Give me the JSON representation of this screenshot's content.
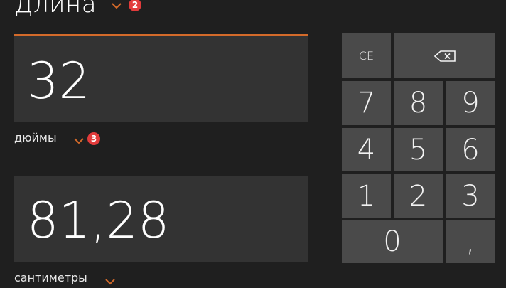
{
  "header": {
    "title": "Длина",
    "badge": "2"
  },
  "from": {
    "value": "32",
    "unit": "дюймы",
    "badge": "3"
  },
  "to": {
    "value": "81,28",
    "unit": "сантиметры"
  },
  "keypad": {
    "ce": "CE",
    "k7": "7",
    "k8": "8",
    "k9": "9",
    "k4": "4",
    "k5": "5",
    "k6": "6",
    "k1": "1",
    "k2": "2",
    "k3": "3",
    "k0": "0",
    "decimal": ","
  },
  "colors": {
    "accent": "#d36a2a",
    "badge": "#e23b3b",
    "background": "#1f1f1f",
    "field": "#333333",
    "key": "#4a4a4a"
  }
}
